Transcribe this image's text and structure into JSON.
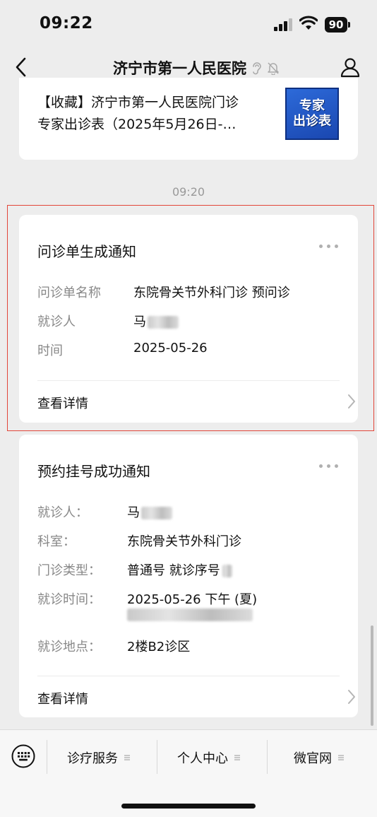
{
  "status_bar": {
    "time": "09:22",
    "battery": "90"
  },
  "nav": {
    "title": "济宁市第一人民医院"
  },
  "article": {
    "line1": "【收藏】济宁市第一人民医院门诊",
    "line2": "专家出诊表（2025年5月26日-…",
    "thumb_line1": "专家",
    "thumb_line2": "出诊表"
  },
  "timestamp": "09:20",
  "msg1": {
    "title": "问诊单生成通知",
    "fields": [
      {
        "label": "问诊单名称",
        "value": "东院骨关节外科门诊 预问诊"
      },
      {
        "label": "就诊人",
        "value": "马"
      },
      {
        "label": "时间",
        "value": "2025-05-26"
      }
    ],
    "detail": "查看详情"
  },
  "msg2": {
    "title": "预约挂号成功通知",
    "fields": [
      {
        "label": "就诊人：",
        "value": "马"
      },
      {
        "label": "科室：",
        "value": "东院骨关节外科门诊"
      },
      {
        "label": "门诊类型：",
        "value": "普通号 就诊序号"
      },
      {
        "label": "就诊时间：",
        "value": "2025-05-26 下午 (夏)"
      },
      {
        "label": "就诊地点：",
        "value": "2楼B2诊区"
      }
    ],
    "detail": "查看详情"
  },
  "bottom_menu": {
    "items": [
      {
        "label": "诊疗服务"
      },
      {
        "label": "个人中心"
      },
      {
        "label": "微官网"
      }
    ]
  },
  "colors": {
    "highlight": "#e2463a",
    "background": "#ededed"
  }
}
